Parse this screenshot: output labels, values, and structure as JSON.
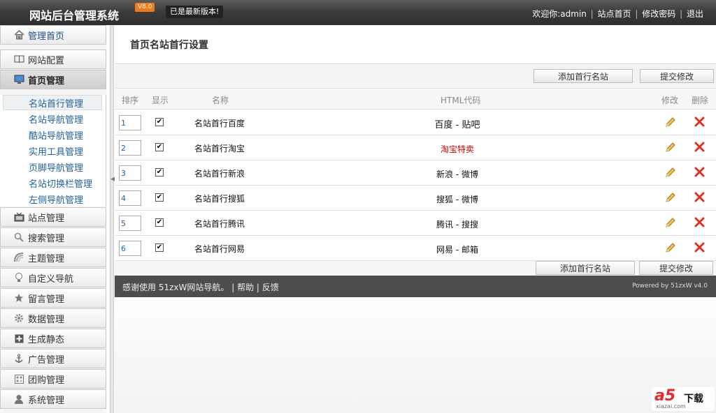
{
  "header": {
    "title": "网站后台管理系统",
    "version_badge": "V8.0",
    "update_status": "已是最新版本!",
    "welcome": "欢迎你:admin",
    "site_home": "站点首页",
    "change_password": "修改密码",
    "logout": "退出",
    "separator": "|"
  },
  "sidebar": {
    "items": [
      {
        "label": "管理首页",
        "icon": "home-icon"
      },
      {
        "label": "网站配置",
        "icon": "book-icon"
      },
      {
        "label": "首页管理",
        "icon": "monitor-icon"
      },
      {
        "label": "站点管理",
        "icon": "tv-icon"
      },
      {
        "label": "搜索管理",
        "icon": "search-icon"
      },
      {
        "label": "主题管理",
        "icon": "theme-icon"
      },
      {
        "label": "自定义导航",
        "icon": "bulb-icon"
      },
      {
        "label": "留言管理",
        "icon": "star-icon"
      },
      {
        "label": "数据管理",
        "icon": "gear-icon"
      },
      {
        "label": "生成静态",
        "icon": "plus-box-icon"
      },
      {
        "label": "广告管理",
        "icon": "anchor-icon"
      },
      {
        "label": "团购管理",
        "icon": "grid-icon"
      },
      {
        "label": "系统管理",
        "icon": "user-icon"
      }
    ],
    "subitems": [
      {
        "label": "名站首行管理"
      },
      {
        "label": "名站导航管理"
      },
      {
        "label": "酷站导航管理"
      },
      {
        "label": "实用工具管理"
      },
      {
        "label": "页脚导航管理"
      },
      {
        "label": "名站切换栏管理"
      },
      {
        "label": "左侧导航管理"
      }
    ]
  },
  "page": {
    "title": "首页名站首行设置",
    "add_button": "添加首行名站",
    "submit_button": "提交修改"
  },
  "table": {
    "headers": [
      "排序",
      "显示",
      "名称",
      "HTML代码",
      "修改",
      "删除"
    ],
    "rows": [
      {
        "sort": "1",
        "shown": true,
        "name": "名站首行百度",
        "html": "百度 - 贴吧"
      },
      {
        "sort": "2",
        "shown": true,
        "name": "名站首行淘宝",
        "html": "淘宝特卖"
      },
      {
        "sort": "3",
        "shown": true,
        "name": "名站首行新浪",
        "html": "新浪 - 微博"
      },
      {
        "sort": "4",
        "shown": true,
        "name": "名站首行搜狐",
        "html": "搜狐 - 微博"
      },
      {
        "sort": "5",
        "shown": true,
        "name": "名站首行腾讯",
        "html": "腾讯 - 搜搜"
      },
      {
        "sort": "6",
        "shown": true,
        "name": "名站首行网易",
        "html": "网易 - 邮箱"
      }
    ]
  },
  "footer": {
    "thanks": "感谢使用 51zxW网站导航。",
    "help": "帮助",
    "feedback": "反馈",
    "separator": "|",
    "powered": "Powered by 51zxW v4.0"
  },
  "watermark": {
    "logo": "a5",
    "label": "下载",
    "url": "xiazai.com"
  },
  "colors": {
    "header_bg": "#3a3a3a",
    "version_badge": "#f07a1a",
    "link_blue": "#2262a0",
    "footer_bg": "#4d4d4d",
    "delete_red": "#e03020",
    "taobao_red": "#cc0000"
  }
}
